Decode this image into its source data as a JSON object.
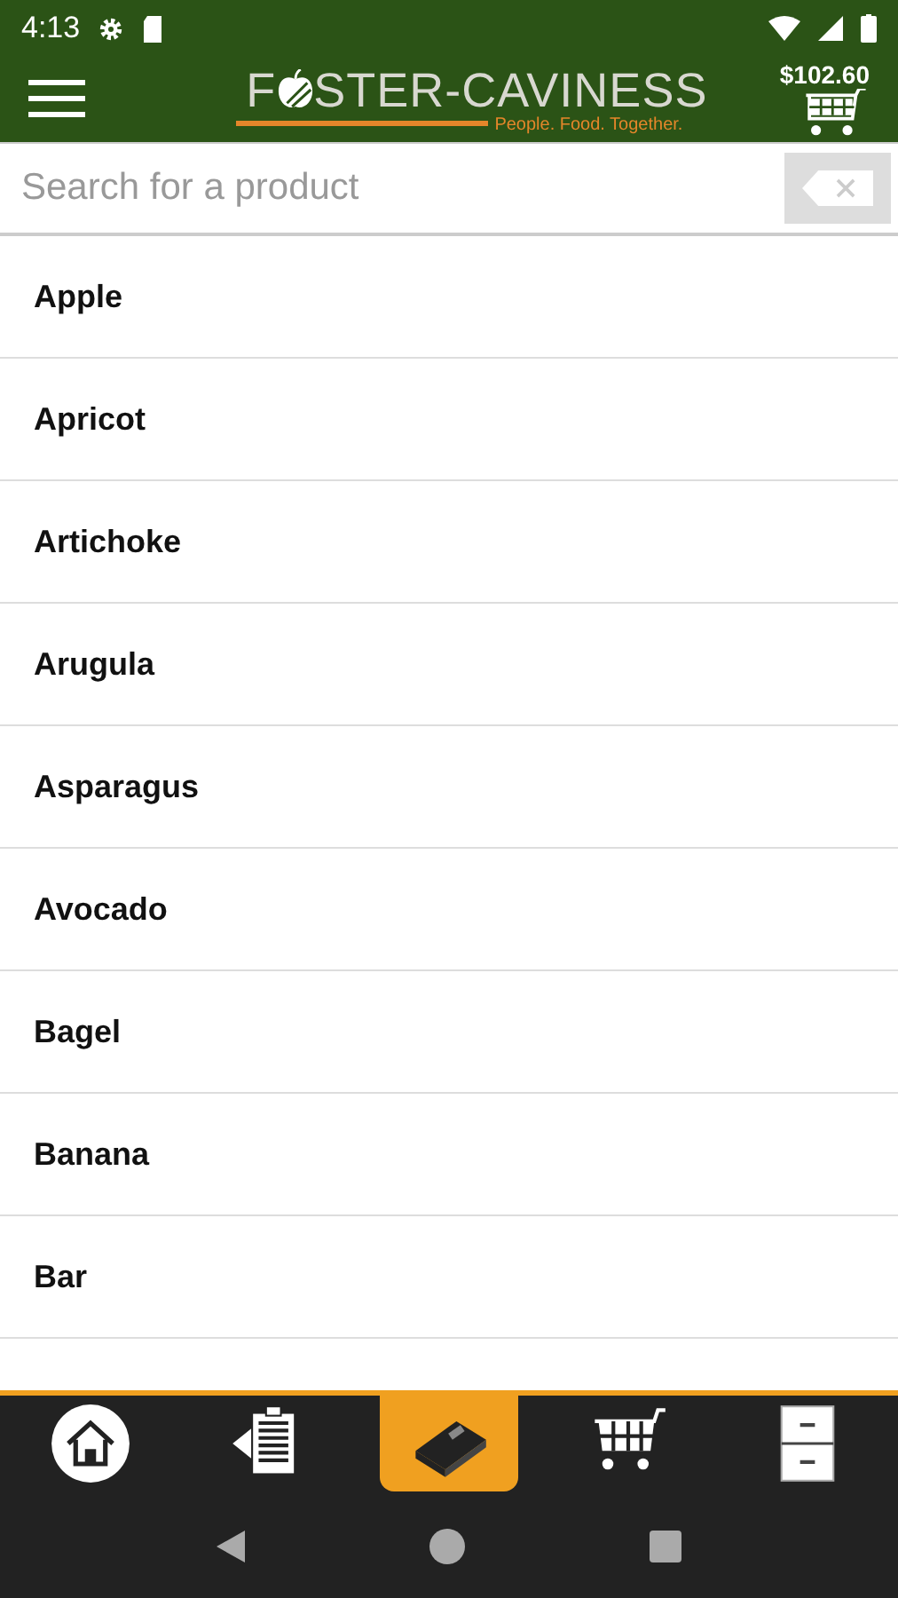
{
  "status_bar": {
    "time": "4:13"
  },
  "header": {
    "logo_start": "F",
    "logo_end": "STER-CAVINESS",
    "tagline": "People. Food. Together.",
    "cart_total": "$102.60"
  },
  "search": {
    "placeholder": "Search for a product"
  },
  "products": [
    {
      "name": "Apple"
    },
    {
      "name": "Apricot"
    },
    {
      "name": "Artichoke"
    },
    {
      "name": "Arugula"
    },
    {
      "name": "Asparagus"
    },
    {
      "name": "Avocado"
    },
    {
      "name": "Bagel"
    },
    {
      "name": "Banana"
    },
    {
      "name": "Bar"
    }
  ],
  "tabs": [
    {
      "kind": "home",
      "selected": false
    },
    {
      "kind": "list",
      "selected": false
    },
    {
      "kind": "catalog",
      "selected": true
    },
    {
      "kind": "cart",
      "selected": false
    },
    {
      "kind": "cabinet",
      "selected": false
    }
  ]
}
